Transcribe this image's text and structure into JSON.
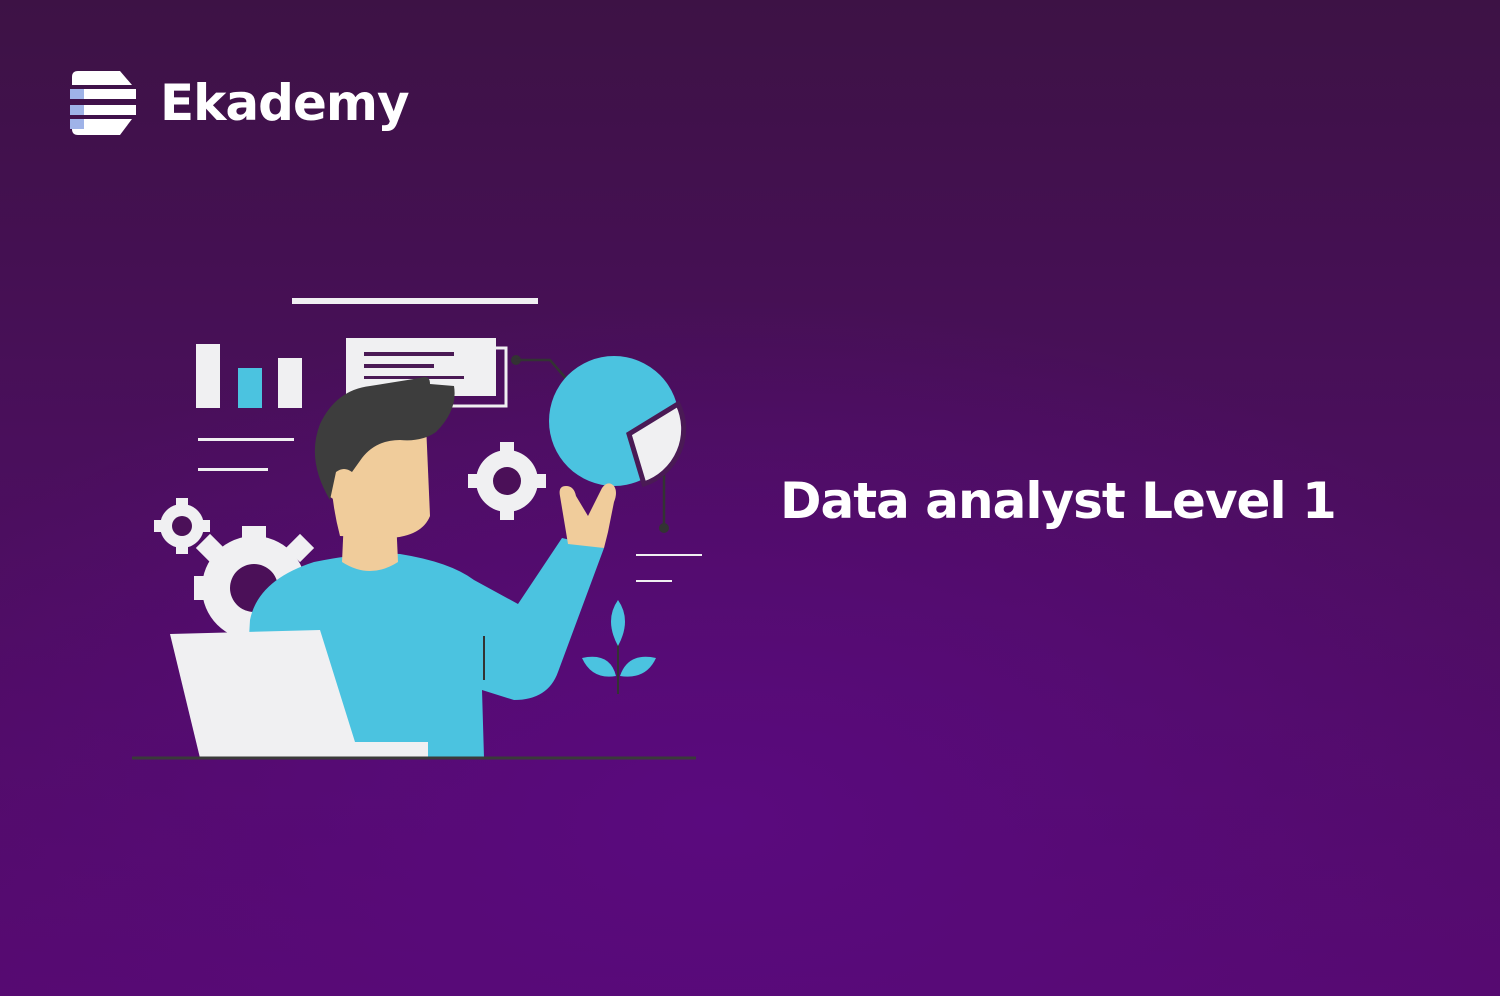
{
  "brand": {
    "name": "Ekademy",
    "icon": "ekademy-logo-mark"
  },
  "course": {
    "title": "Data analyst Level 1"
  },
  "illustration": {
    "subject": "data-analyst-at-laptop",
    "icons": [
      "bar-chart-icon",
      "document-icon",
      "pie-chart-icon",
      "gear-icon",
      "plant-icon",
      "laptop-icon"
    ]
  },
  "colors": {
    "background_top": "#3d1245",
    "background_bottom": "#560a70",
    "accent_blue": "#4bc3e0",
    "skin": "#f0cc9b",
    "hair": "#3d3d3d",
    "light_gray": "#f0f0f2",
    "text": "#ffffff"
  }
}
